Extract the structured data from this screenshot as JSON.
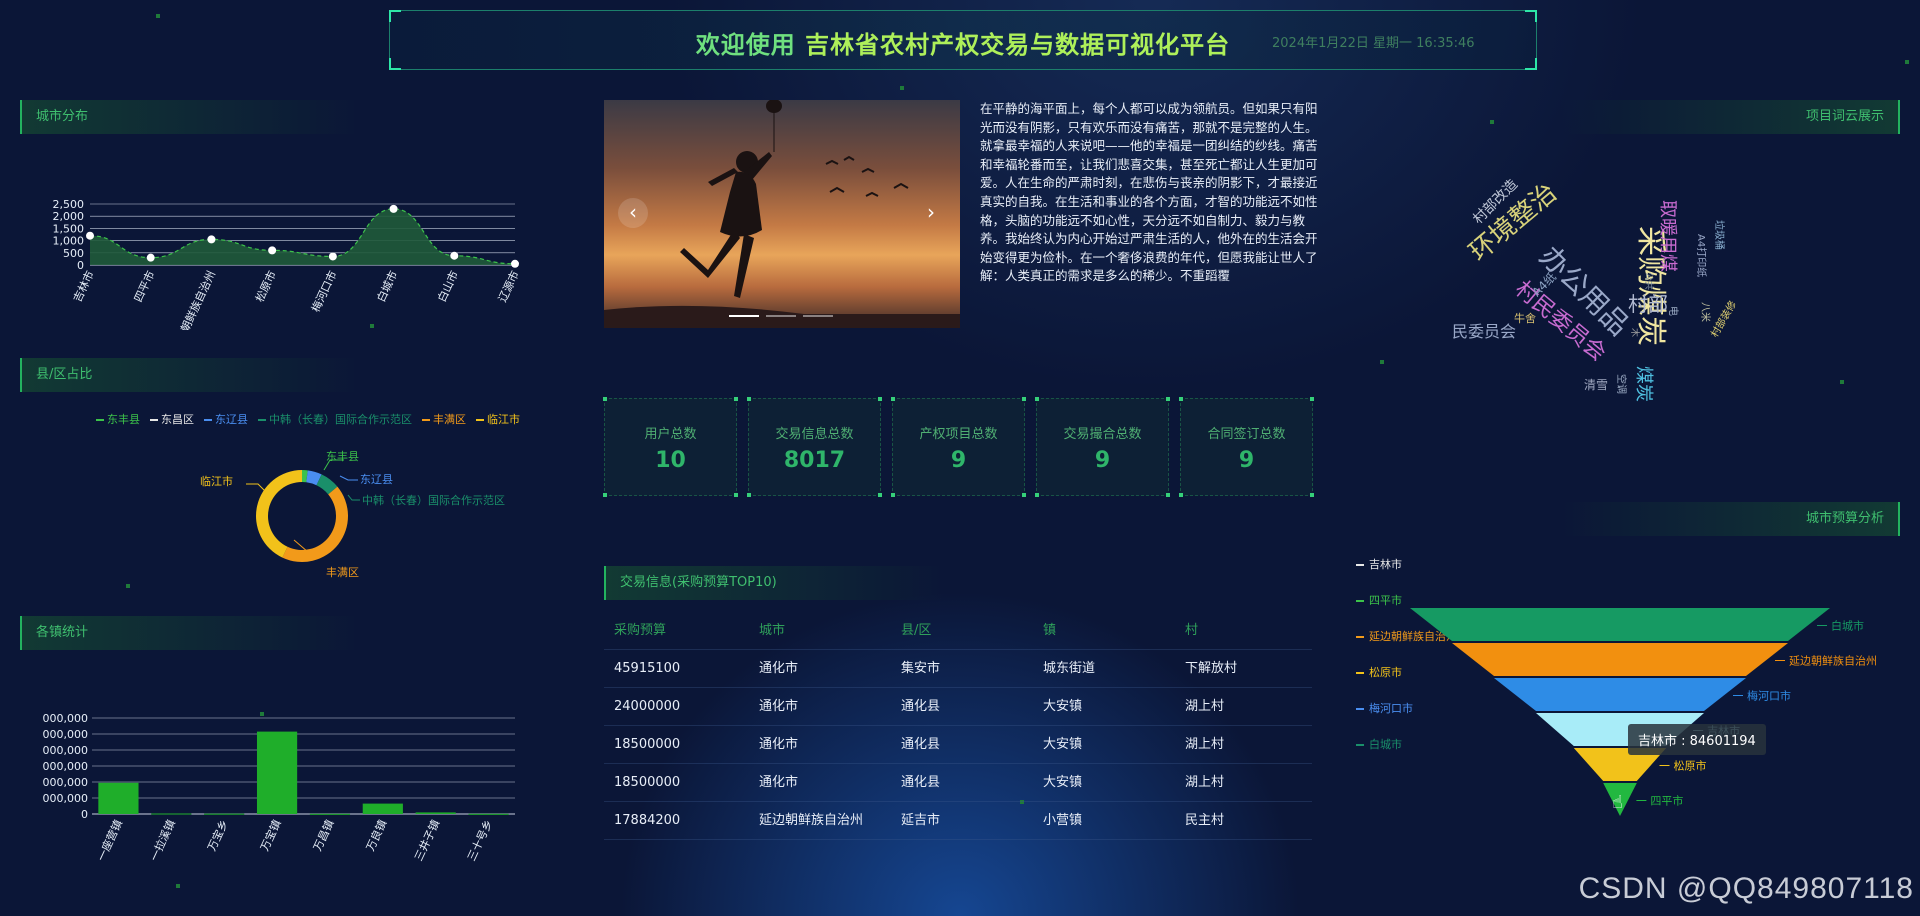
{
  "header": {
    "title_a": "欢迎使用",
    "title_b": "吉林省农村产权交易与数据可视化平台",
    "datetime": "2024年1月22日 星期一 16:35:46"
  },
  "panels": {
    "city": "城市分布",
    "county": "县/区占比",
    "town": "各镇统计",
    "wordcloud": "项目词云展示",
    "budget": "城市预算分析",
    "trade": "交易信息(采购预算TOP10)"
  },
  "city_chart": {
    "type": "area",
    "categories": [
      "吉林市",
      "四平市",
      "朝鲜族自治州",
      "松原市",
      "梅河口市",
      "白城市",
      "白山市",
      "辽源市"
    ],
    "values": [
      1200,
      300,
      1050,
      600,
      350,
      2300,
      380,
      50
    ],
    "yticks": [
      "2,500",
      "2,000",
      "1,500",
      "1,000",
      "500",
      "0"
    ],
    "ylim": [
      0,
      2500
    ]
  },
  "donut": {
    "legend": [
      "东丰县",
      "东昌区",
      "东辽县",
      "中韩（长春）国际合作示范区",
      "丰满区",
      "临江市"
    ],
    "legend_colors": [
      "#3cc24a",
      "#e6e6e6",
      "#4a8ef0",
      "#1a8f6a",
      "#f29a1a",
      "#f2c21a"
    ],
    "slices": [
      {
        "name": "东丰县",
        "value": 2,
        "color": "#3cc24a"
      },
      {
        "name": "东辽县",
        "value": 5,
        "color": "#4a8ef0"
      },
      {
        "name": "中韩（长春）国际合作示范区",
        "value": 7,
        "color": "#1a8f6a"
      },
      {
        "name": "丰满区",
        "value": 43,
        "color": "#f29a1a"
      },
      {
        "name": "临江市",
        "value": 43,
        "color": "#f2c21a"
      }
    ],
    "labels": {
      "a": "东丰县",
      "b": "东辽县",
      "c": "中韩（长春）国际合作示范区",
      "d": "丰满区",
      "e": "临江市"
    }
  },
  "town_chart": {
    "type": "bar",
    "categories": [
      "一座营镇",
      "一拉溪镇",
      "万宝乡",
      "万宝镇",
      "万昌镇",
      "万良镇",
      "三井子镇",
      "三十号乡"
    ],
    "values": [
      1950000,
      30000,
      20000,
      5150000,
      10000,
      650000,
      100000,
      10000
    ],
    "yticks": [
      "000,000",
      "000,000",
      "000,000",
      "000,000",
      "000,000",
      "000,000",
      "0"
    ],
    "ylim": [
      0,
      6000000
    ]
  },
  "carousel": {
    "prev": "‹",
    "next": "›"
  },
  "article": "在平静的海平面上，每个人都可以成为领航员。但如果只有阳光而没有阴影，只有欢乐而没有痛苦，那就不是完整的人生。就拿最幸福的人来说吧——他的幸福是一团纠结的纱线。痛苦和幸福轮番而至，让我们悲喜交集，甚至死亡都让人生更加可爱。人在生命的严肃时刻，在悲伤与丧亲的阴影下，才最接近真实的自我。在生活和事业的各个方面，才智的功能远不如性格，头脑的功能远不如心性，天分远不如自制力、毅力与教养。我始终认为内心开始过严肃生活的人，他外在的生活会开始变得更为俭朴。在一个奢侈浪费的年代，但愿我能让世人了解：人类真正的需求是多么的稀少。不重蹈覆",
  "stats": [
    {
      "label": "用户总数",
      "value": "10"
    },
    {
      "label": "交易信息总数",
      "value": "8017"
    },
    {
      "label": "产权项目总数",
      "value": "9"
    },
    {
      "label": "交易撮合总数",
      "value": "9"
    },
    {
      "label": "合同签订总数",
      "value": "9"
    }
  ],
  "trade": {
    "columns": [
      "采购预算",
      "城市",
      "县/区",
      "镇",
      "村"
    ],
    "rows": [
      [
        "45915100",
        "通化市",
        "集安市",
        "城东街道",
        "下解放村"
      ],
      [
        "24000000",
        "通化市",
        "通化县",
        "大安镇",
        "湖上村"
      ],
      [
        "18500000",
        "通化市",
        "通化县",
        "大安镇",
        "湖上村"
      ],
      [
        "18500000",
        "通化市",
        "通化县",
        "大安镇",
        "湖上村"
      ],
      [
        "17884200",
        "延边朝鲜族自治州",
        "延吉市",
        "小营镇",
        "民主村"
      ]
    ]
  },
  "wordcloud": [
    {
      "t": "采购煤炭",
      "c": "#f0e6a0"
    },
    {
      "t": "环境整治",
      "c": "#d8d27a"
    },
    {
      "t": "办公用品",
      "c": "#9aa8c8"
    },
    {
      "t": "村民委员会",
      "c": "#c76bd0"
    },
    {
      "t": "取暖用煤",
      "c": "#c86bd0"
    },
    {
      "t": "村部",
      "c": "#b0b8d0"
    },
    {
      "t": "民委员会",
      "c": "#9aa8c8"
    },
    {
      "t": "村部改造",
      "c": "#c0c8d8"
    },
    {
      "t": "A4纸",
      "c": "#8aa0c0"
    },
    {
      "t": "牛舍",
      "c": "#d8c070"
    },
    {
      "t": "清雪",
      "c": "#a0a8c0"
    },
    {
      "t": "煤炭",
      "c": "#4fc0e0"
    },
    {
      "t": "A4打印纸",
      "c": "#9aa8c8"
    },
    {
      "t": "垃圾桶",
      "c": "#8ab0d0"
    },
    {
      "t": "村部装修",
      "c": "#e0d070"
    },
    {
      "t": "空调",
      "c": "#a0b0c8"
    },
    {
      "t": "电",
      "c": "#a0b0c8"
    },
    {
      "t": "八米",
      "c": "#c0c0a0"
    },
    {
      "t": "木",
      "c": "#a0a0a0"
    },
    {
      "t": "公共",
      "c": "#8090a0"
    }
  ],
  "funnel": {
    "legend": [
      "吉林市",
      "四平市",
      "延边朝鲜族自治州",
      "松原市",
      "梅河口市",
      "白城市"
    ],
    "legend_colors": [
      "#e8e8e8",
      "#3cc24a",
      "#f29a1a",
      "#f2c21a",
      "#4a8ef0",
      "#1a8f6a"
    ],
    "levels": [
      {
        "name": "白城市",
        "value": 100,
        "color": "#169a63"
      },
      {
        "name": "延边朝鲜族自治州",
        "value": 80,
        "color": "#f2900f"
      },
      {
        "name": "梅河口市",
        "value": 60,
        "color": "#2e8ce6"
      },
      {
        "name": "吉林市",
        "value": 40,
        "color": "#a8ecf8"
      },
      {
        "name": "松原市",
        "value": 22,
        "color": "#f2c21a"
      },
      {
        "name": "四平市",
        "value": 8,
        "color": "#22b840"
      }
    ],
    "tooltip": "吉林市 : 84601194"
  },
  "watermark": "CSDN @QQ849807118"
}
